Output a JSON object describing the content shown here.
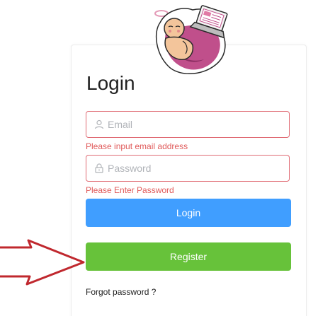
{
  "login_form": {
    "title": "Login",
    "email": {
      "placeholder": "Email",
      "value": "",
      "error": "Please input email address"
    },
    "password": {
      "placeholder": "Password",
      "value": "",
      "error": "Please Enter Password"
    },
    "login_label": "Login",
    "register_label": "Register",
    "forgot_label": "Forgot password ?"
  },
  "icons": {
    "email": "user-icon",
    "password": "lock-icon"
  },
  "colors": {
    "error": "#e05a5a",
    "primary": "#409eff",
    "success": "#67c23a",
    "annotation_arrow": "#c0282e"
  }
}
